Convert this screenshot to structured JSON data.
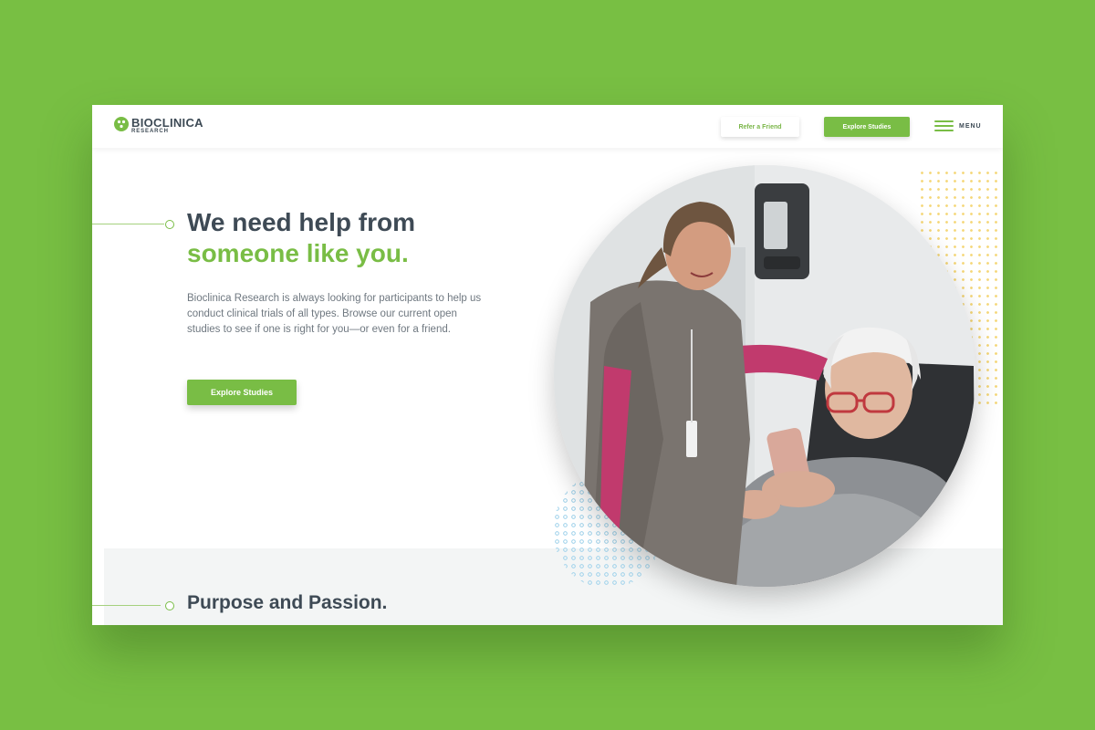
{
  "header": {
    "logo_name": "BIOCLINICA",
    "logo_sub": "RESEARCH",
    "refer_label": "Refer a Friend",
    "explore_label": "Explore Studies",
    "menu_label": "MENU"
  },
  "hero": {
    "headline_line1": "We need help from",
    "headline_line2": "someone like you.",
    "intro": "Bioclinica Research is always looking for participants to help us conduct clinical trials of all types. Browse our current open studies to see if one is right for you—or even for a friend.",
    "cta_label": "Explore Studies"
  },
  "section2": {
    "title": "Purpose and Passion."
  },
  "colors": {
    "page_bg": "#78bf43",
    "brand_green": "#79bd45",
    "heading_dark": "#3e4a55",
    "body_gray": "#6f7880"
  },
  "icons": {
    "logo": "bioclinica-logo-icon",
    "menu": "hamburger-menu-icon"
  }
}
